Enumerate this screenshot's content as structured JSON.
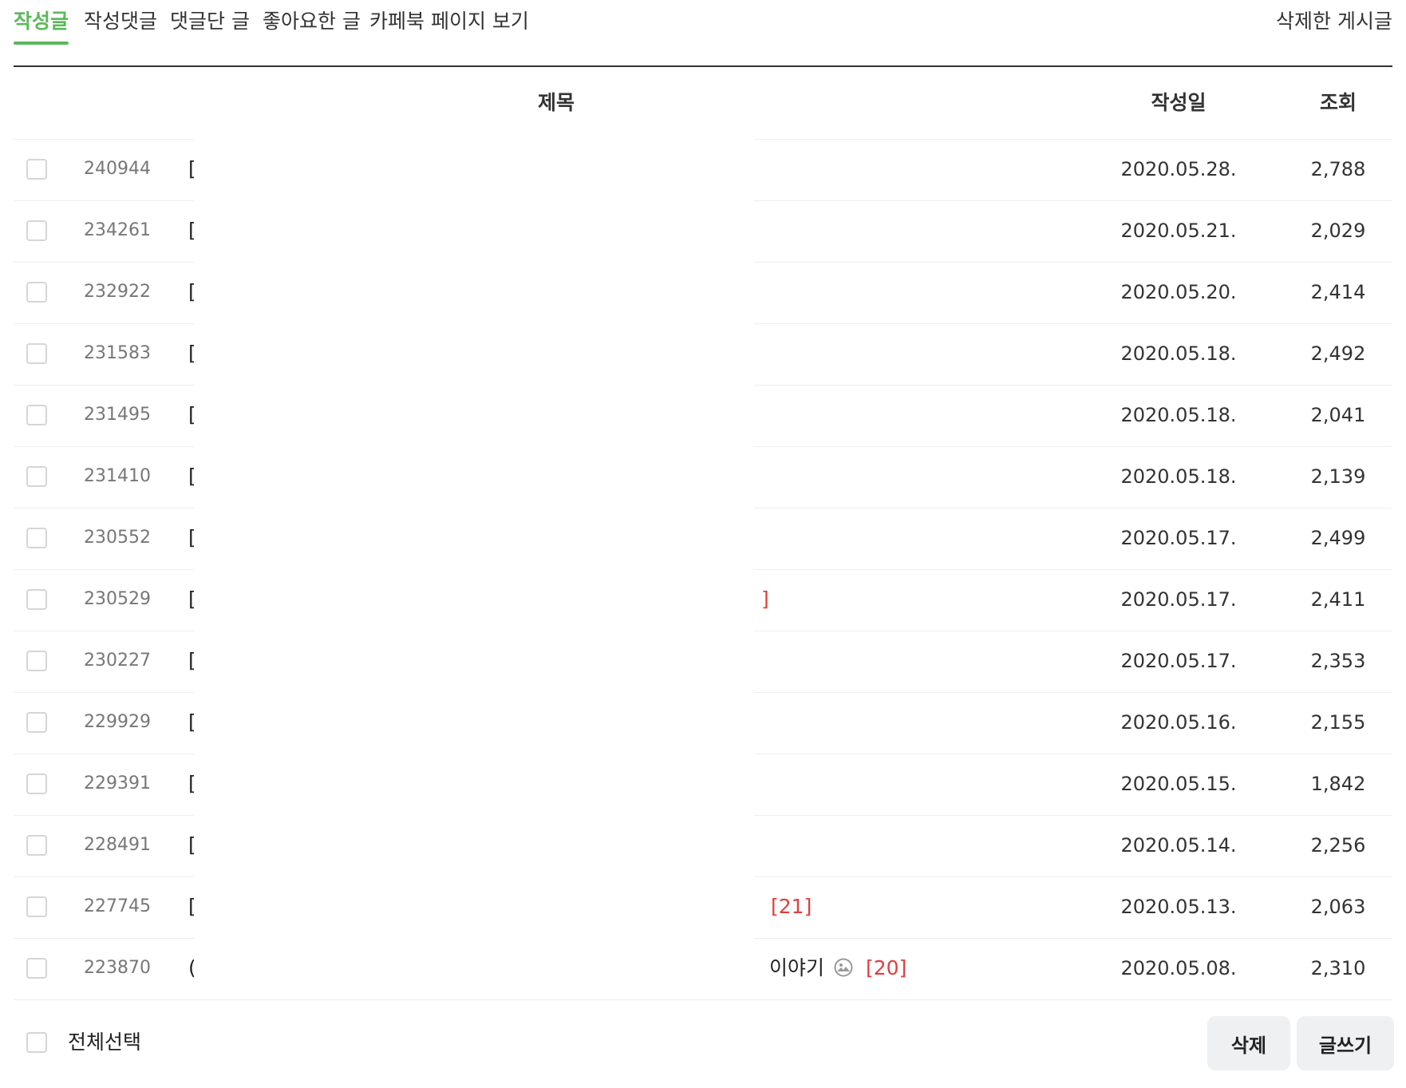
{
  "colors": {
    "accent": "#5cb85c",
    "comment_count": "#e03e3e"
  },
  "tabs": [
    {
      "label": "작성글",
      "active": true
    },
    {
      "label": "작성댓글",
      "active": false
    },
    {
      "label": "댓글단 글",
      "active": false
    },
    {
      "label": "좋아요한 글",
      "active": false
    },
    {
      "label": "카페북 페이지 보기",
      "active": false
    }
  ],
  "deleted_posts_link": "삭제한 게시글",
  "table": {
    "headers": {
      "title": "제목",
      "date": "작성일",
      "views": "조회"
    },
    "rows": [
      {
        "id": "240944",
        "title": "[",
        "suffix": "",
        "has_image": false,
        "comments": "",
        "date": "2020.05.28.",
        "views": "2,788"
      },
      {
        "id": "234261",
        "title": "[",
        "suffix": "",
        "has_image": false,
        "comments": "",
        "date": "2020.05.21.",
        "views": "2,029"
      },
      {
        "id": "232922",
        "title": "[",
        "suffix": "",
        "has_image": false,
        "comments": "",
        "date": "2020.05.20.",
        "views": "2,414"
      },
      {
        "id": "231583",
        "title": "[",
        "suffix": "",
        "has_image": false,
        "comments": "",
        "date": "2020.05.18.",
        "views": "2,492"
      },
      {
        "id": "231495",
        "title": "[",
        "suffix": "",
        "has_image": false,
        "comments": "",
        "date": "2020.05.18.",
        "views": "2,041"
      },
      {
        "id": "231410",
        "title": "[",
        "suffix": "",
        "has_image": false,
        "comments": "",
        "date": "2020.05.18.",
        "views": "2,139"
      },
      {
        "id": "230552",
        "title": "[",
        "suffix": "",
        "has_image": false,
        "comments": "",
        "date": "2020.05.17.",
        "views": "2,499"
      },
      {
        "id": "230529",
        "title": "[",
        "suffix": "",
        "has_image": false,
        "comments": "]",
        "date": "2020.05.17.",
        "views": "2,411"
      },
      {
        "id": "230227",
        "title": "[",
        "suffix": "",
        "has_image": false,
        "comments": "",
        "date": "2020.05.17.",
        "views": "2,353"
      },
      {
        "id": "229929",
        "title": "[",
        "suffix": "",
        "has_image": false,
        "comments": "",
        "date": "2020.05.16.",
        "views": "2,155"
      },
      {
        "id": "229391",
        "title": "[",
        "suffix": "",
        "has_image": false,
        "comments": "",
        "date": "2020.05.15.",
        "views": "1,842"
      },
      {
        "id": "228491",
        "title": "[",
        "suffix": "",
        "has_image": false,
        "comments": "",
        "date": "2020.05.14.",
        "views": "2,256"
      },
      {
        "id": "227745",
        "title": "[",
        "suffix": "",
        "has_image": false,
        "comments": "[21]",
        "date": "2020.05.13.",
        "views": "2,063"
      },
      {
        "id": "223870",
        "title": "(",
        "suffix": "이야기",
        "has_image": true,
        "comments": "[20]",
        "date": "2020.05.08.",
        "views": "2,310"
      }
    ]
  },
  "footer": {
    "select_all_label": "전체선택",
    "delete_button": "삭제",
    "write_button": "글쓰기"
  }
}
